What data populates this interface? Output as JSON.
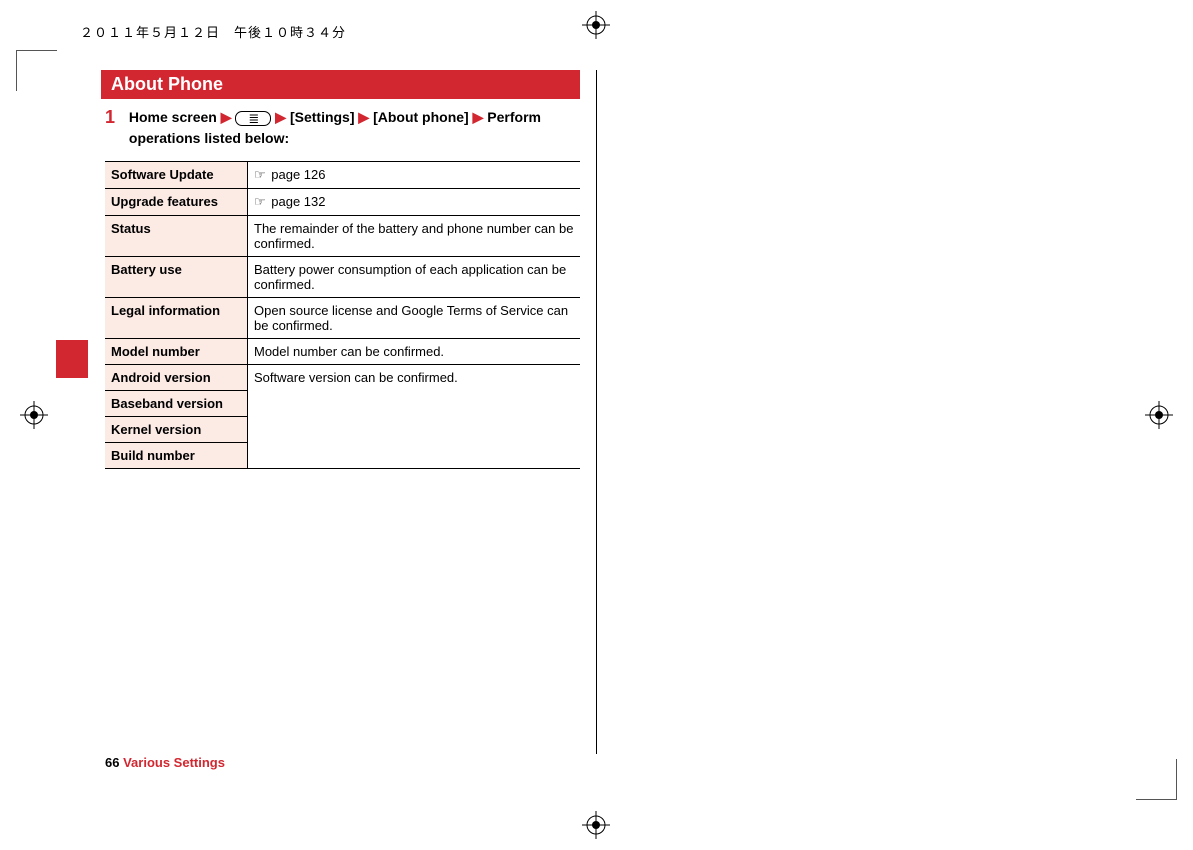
{
  "timestamp": "２０１１年５月１２日　午後１０時３４分",
  "section_title": "About Phone",
  "step_number": "1",
  "step_parts": {
    "a": "Home screen",
    "b": "[Settings]",
    "c": "[About phone]",
    "d": "Perform operations listed below:"
  },
  "arrow": "▶",
  "ref_icon": "☞",
  "table_rows": [
    {
      "label": "Software Update",
      "desc_prefix": "☞",
      "desc": " page 126"
    },
    {
      "label": "Upgrade features",
      "desc_prefix": "☞",
      "desc": " page 132"
    },
    {
      "label": "Status",
      "desc": "The remainder of the battery and phone number can be confirmed."
    },
    {
      "label": "Battery use",
      "desc": "Battery power consumption of each application can be confirmed."
    },
    {
      "label": "Legal information",
      "desc": "Open source license and Google Terms of Service can be confirmed."
    },
    {
      "label": "Model number",
      "desc": "Model number can be confirmed."
    }
  ],
  "version_group": {
    "labels": [
      "Android version",
      "Baseband version",
      "Kernel version",
      "Build number"
    ],
    "desc": "Software version can be confirmed."
  },
  "footer": {
    "page_num": "66",
    "title": "Various Settings"
  }
}
